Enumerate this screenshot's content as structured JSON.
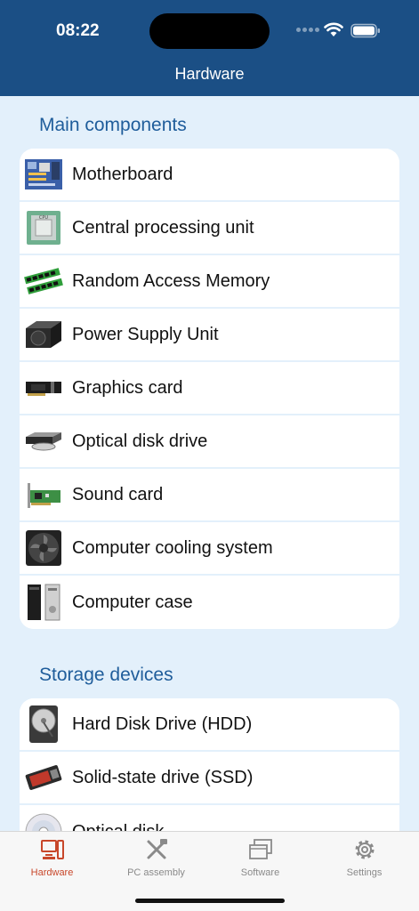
{
  "status": {
    "time": "08:22"
  },
  "nav": {
    "title": "Hardware"
  },
  "sections": [
    {
      "title": "Main components",
      "items": [
        {
          "label": "Motherboard",
          "icon": "motherboard-icon"
        },
        {
          "label": "Central processing unit",
          "icon": "cpu-icon"
        },
        {
          "label": "Random Access Memory",
          "icon": "ram-icon"
        },
        {
          "label": "Power Supply Unit",
          "icon": "psu-icon"
        },
        {
          "label": "Graphics card",
          "icon": "graphics-card-icon"
        },
        {
          "label": "Optical disk drive",
          "icon": "optical-drive-icon"
        },
        {
          "label": "Sound card",
          "icon": "sound-card-icon"
        },
        {
          "label": "Computer cooling system",
          "icon": "cooling-fan-icon"
        },
        {
          "label": "Computer case",
          "icon": "computer-case-icon"
        }
      ]
    },
    {
      "title": "Storage devices",
      "items": [
        {
          "label": "Hard Disk Drive (HDD)",
          "icon": "hdd-icon"
        },
        {
          "label": "Solid-state drive (SSD)",
          "icon": "ssd-icon"
        },
        {
          "label": "Optical disk",
          "icon": "optical-disk-icon"
        }
      ]
    }
  ],
  "tabs": [
    {
      "label": "Hardware",
      "icon": "hardware-icon",
      "active": true
    },
    {
      "label": "PC assembly",
      "icon": "tools-icon",
      "active": false
    },
    {
      "label": "Software",
      "icon": "windows-icon",
      "active": false
    },
    {
      "label": "Settings",
      "icon": "gear-icon",
      "active": false
    }
  ],
  "colors": {
    "header": "#1b4f85",
    "background": "#e3f0fb",
    "section_title": "#1f5d9b",
    "active_tab": "#c8472a",
    "inactive_tab": "#8a8a8a"
  }
}
